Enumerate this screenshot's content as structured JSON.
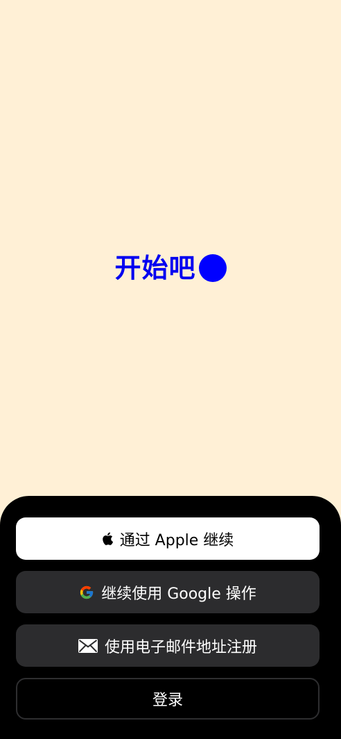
{
  "hero": {
    "title": "开始吧",
    "dot_color": "#0000FF"
  },
  "auth": {
    "apple": {
      "label": "通过 Apple 继续",
      "icon": "apple-icon"
    },
    "google": {
      "label": "继续使用 Google 操作",
      "icon": "google-icon"
    },
    "email": {
      "label": "使用电子邮件地址注册",
      "icon": "mail-icon"
    },
    "login": {
      "label": "登录"
    }
  },
  "colors": {
    "background": "#FFF0D6",
    "accent": "#0000F0",
    "sheet": "#000000",
    "button_dark": "#2C2C2E",
    "button_light": "#FFFFFF"
  }
}
